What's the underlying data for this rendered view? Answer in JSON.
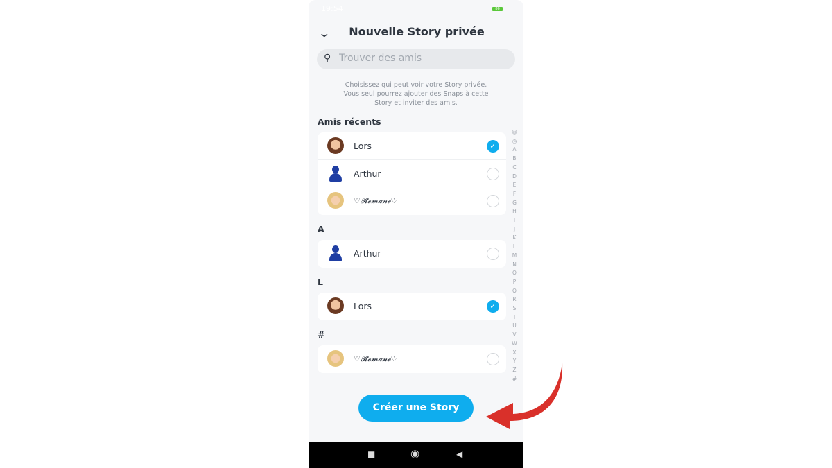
{
  "status": {
    "time": "19:54",
    "battery": "86"
  },
  "header": {
    "title": "Nouvelle Story privée",
    "back_icon": "chevron-down-icon"
  },
  "search": {
    "placeholder": "Trouver des amis"
  },
  "description": "Choisissez qui peut voir votre Story privée. Vous seul pourrez ajouter des Snaps à cette Story et inviter des amis.",
  "sections": [
    {
      "title": "Amis récents",
      "friends": [
        {
          "name": "Lors",
          "selected": true
        },
        {
          "name": "Arthur",
          "selected": false
        },
        {
          "name": "♡𝓡𝓸𝓶𝓪𝓷𝓮♡",
          "selected": false
        }
      ]
    },
    {
      "title": "A",
      "friends": [
        {
          "name": "Arthur",
          "selected": false
        }
      ]
    },
    {
      "title": "L",
      "friends": [
        {
          "name": "Lors",
          "selected": true
        }
      ]
    },
    {
      "title": "#",
      "friends": [
        {
          "name": "♡𝓡𝓸𝓶𝓪𝓷𝓮♡",
          "selected": false
        }
      ]
    }
  ],
  "index": [
    "☺",
    "◷",
    "A",
    "B",
    "C",
    "D",
    "E",
    "F",
    "G",
    "H",
    "I",
    "J",
    "K",
    "L",
    "M",
    "N",
    "O",
    "P",
    "Q",
    "R",
    "S",
    "T",
    "U",
    "V",
    "W",
    "X",
    "Y",
    "Z",
    "#"
  ],
  "cta": {
    "label": "Créer une Story"
  },
  "colors": {
    "accent": "#0fadee",
    "arrow": "#d9302a",
    "text": "#2f3640"
  }
}
